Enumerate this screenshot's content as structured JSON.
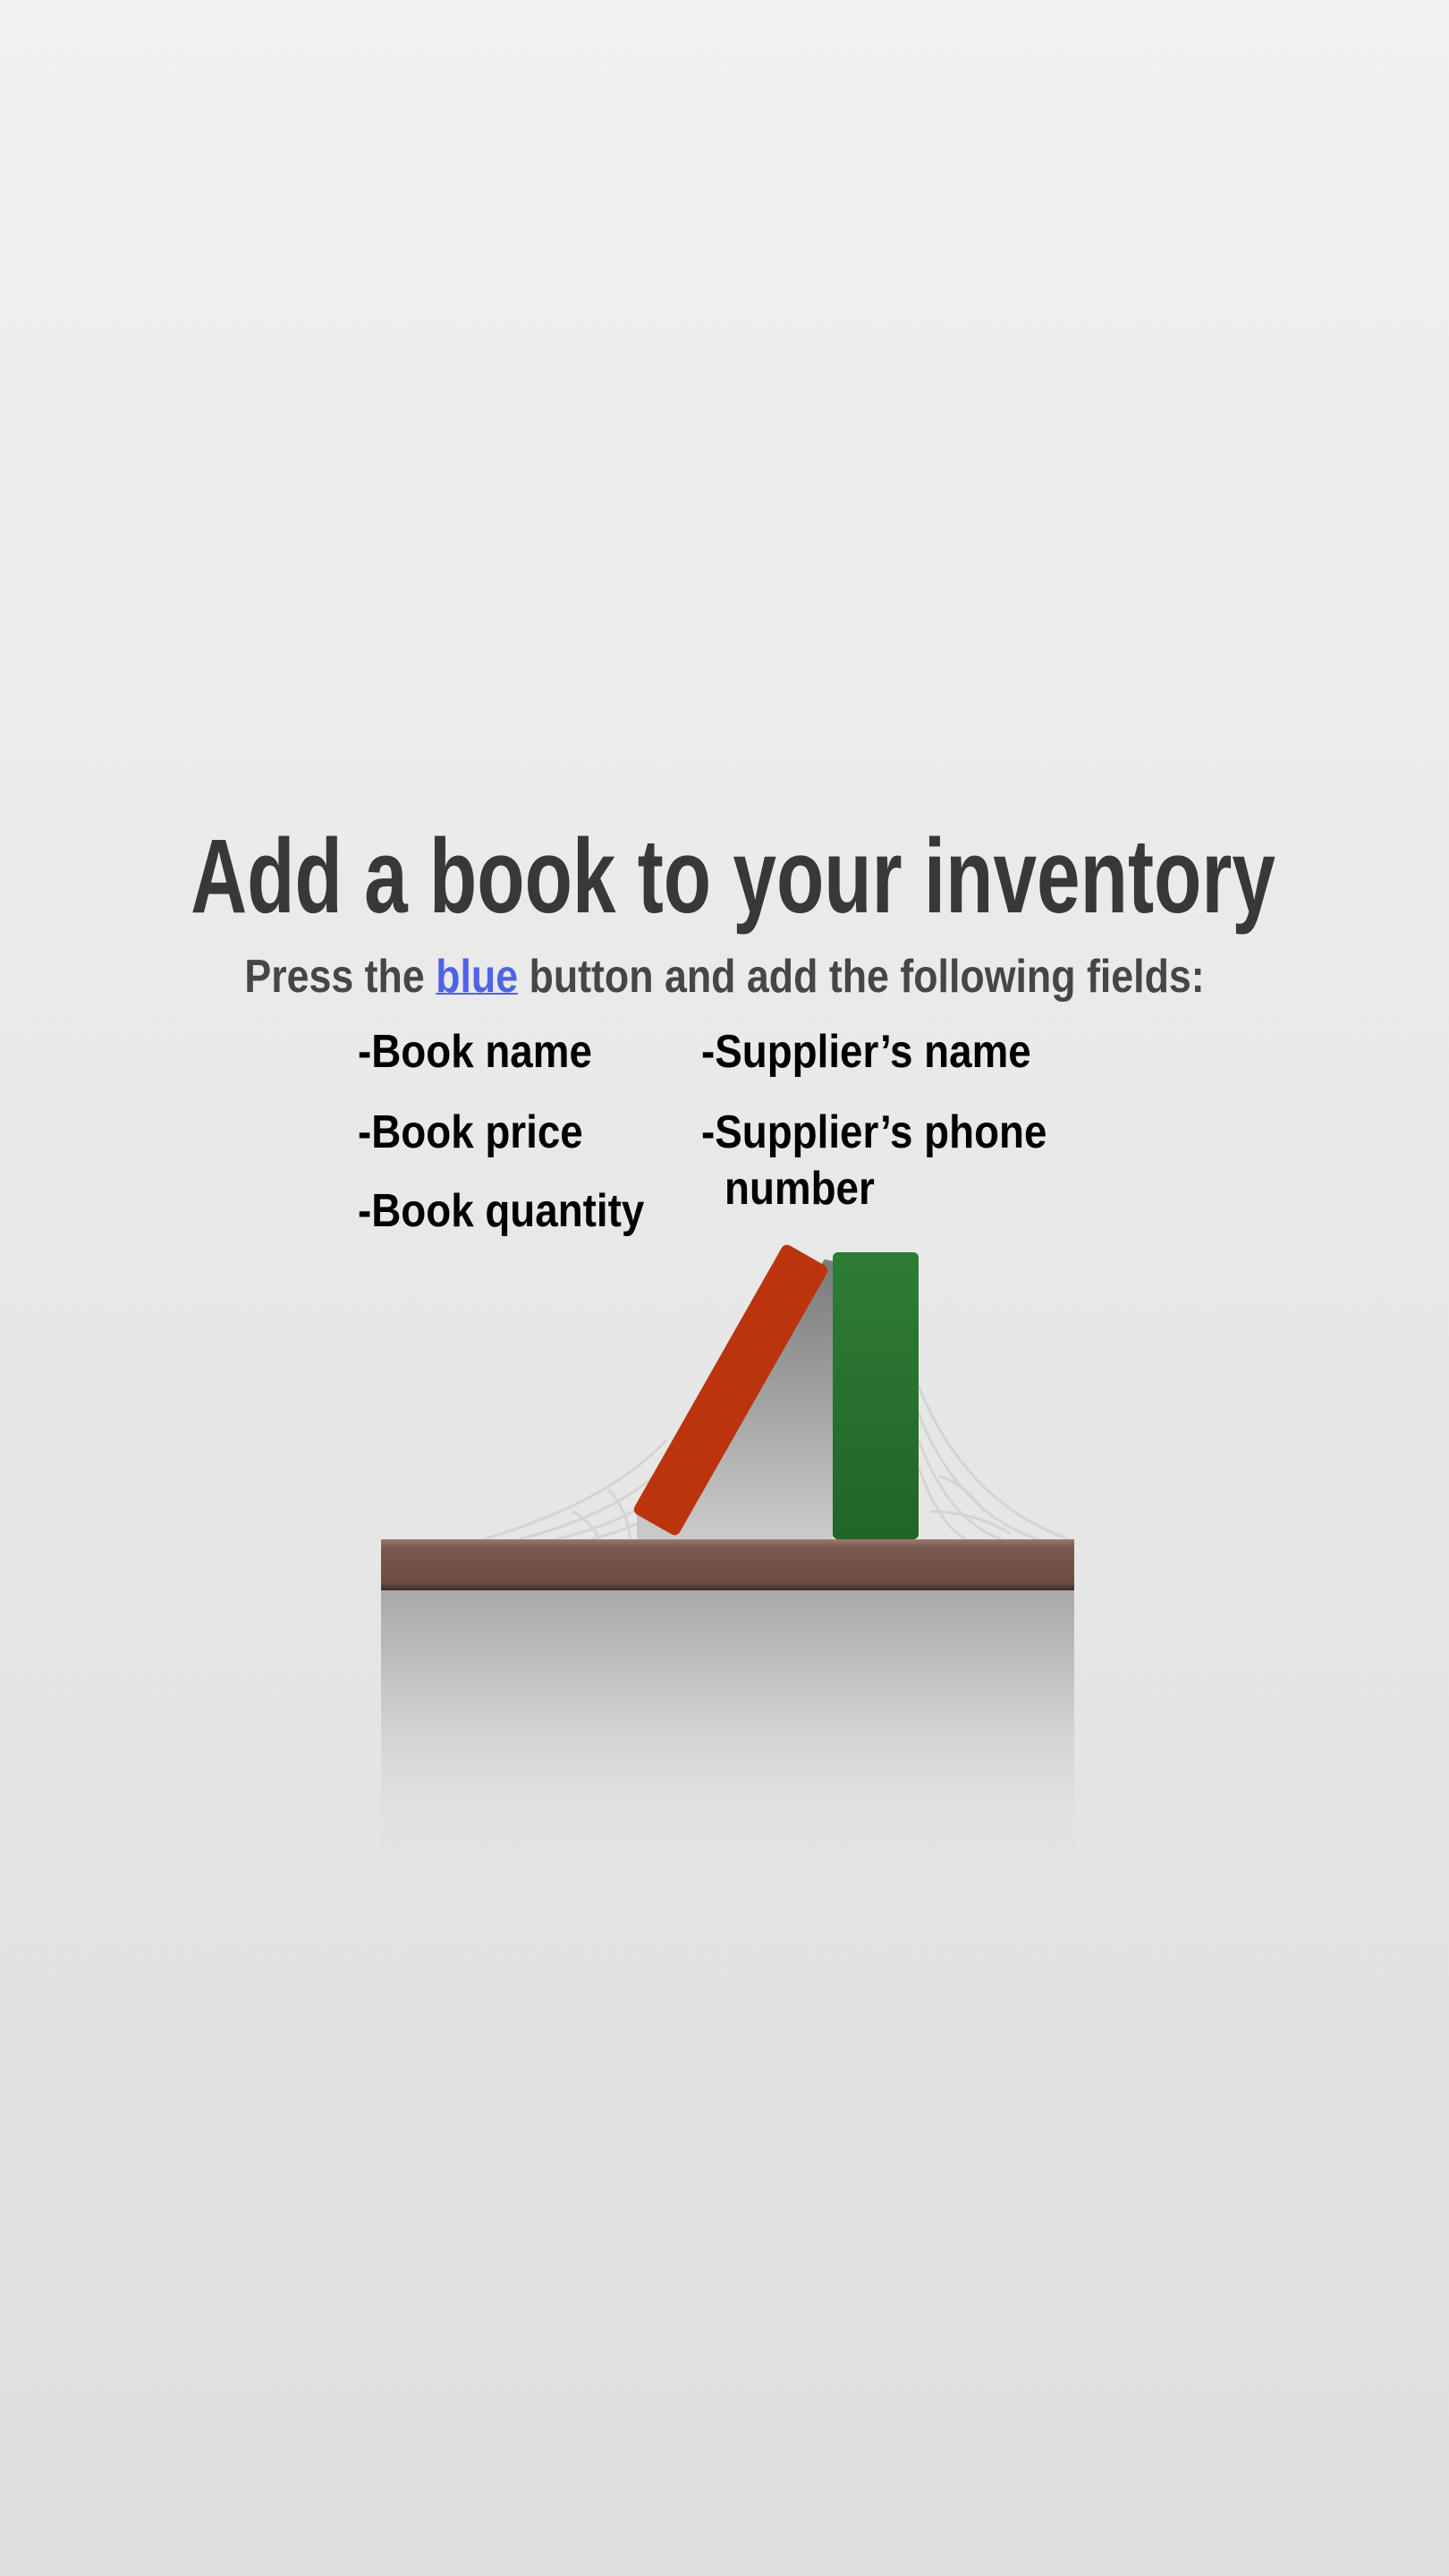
{
  "empty_state": {
    "title": "Add a book to your inventory",
    "subtitle_prefix": "Press the ",
    "subtitle_highlight": "blue",
    "subtitle_suffix": " button and add the following fields:",
    "highlight_color": "#4f63e6",
    "fields_left": [
      "-Book name",
      "-Book price",
      "-Book quantity"
    ],
    "fields_right": [
      "-Supplier’s name",
      "-Supplier’s phone",
      "number"
    ]
  },
  "colors": {
    "red_book": "#bb340e",
    "green_book": "#2a7530",
    "shelf": "#74544a"
  }
}
